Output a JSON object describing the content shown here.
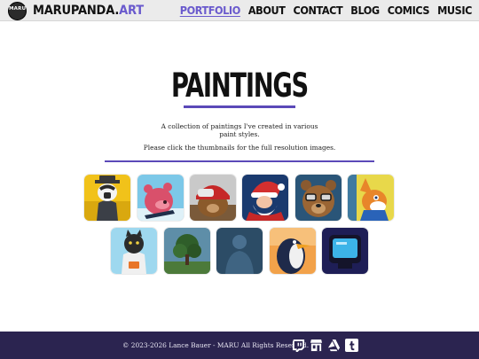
{
  "header": {
    "logo_text": "MARU",
    "brand_main": "MARUPANDA.",
    "brand_accent": "ART",
    "nav": [
      {
        "label": "PORTFOLIO",
        "active": true
      },
      {
        "label": "ABOUT"
      },
      {
        "label": "CONTACT"
      },
      {
        "label": "BLOG"
      },
      {
        "label": "COMICS"
      },
      {
        "label": "MUSIC"
      }
    ]
  },
  "main": {
    "title": "PAINTINGS",
    "intro": "A collection of paintings I've created in various paint styles.",
    "hint": "Please click the thumbnails for the full resolution images.",
    "thumbnails": [
      {
        "name": "badger-knight",
        "bg": "#f1c21a"
      },
      {
        "name": "pink-bear-on-ice",
        "bg": "#7cc8e8"
      },
      {
        "name": "red-helmet-bear",
        "bg": "#c9c9c9"
      },
      {
        "name": "santa-claus",
        "bg": "#1a3a6e"
      },
      {
        "name": "bear-with-glasses",
        "bg": "#2a5578"
      },
      {
        "name": "fox-character",
        "bg": "#e8d84a"
      },
      {
        "name": "astronaut-cat",
        "bg": "#9ed8ef"
      },
      {
        "name": "tree-landscape",
        "bg": "#5e8ea8"
      },
      {
        "name": "figure-silhouette",
        "bg": "#2c4c66"
      },
      {
        "name": "penguin-character",
        "bg": "#f2a24a"
      },
      {
        "name": "crt-monitor",
        "bg": "#1e1e56"
      }
    ]
  },
  "footer": {
    "copyright": "© 2023-2026 Lance Bauer - MARU All Rights Reserved.",
    "social_icons": [
      "twitch-icon",
      "storefront-icon",
      "artstation-icon",
      "tumblr-icon"
    ]
  }
}
